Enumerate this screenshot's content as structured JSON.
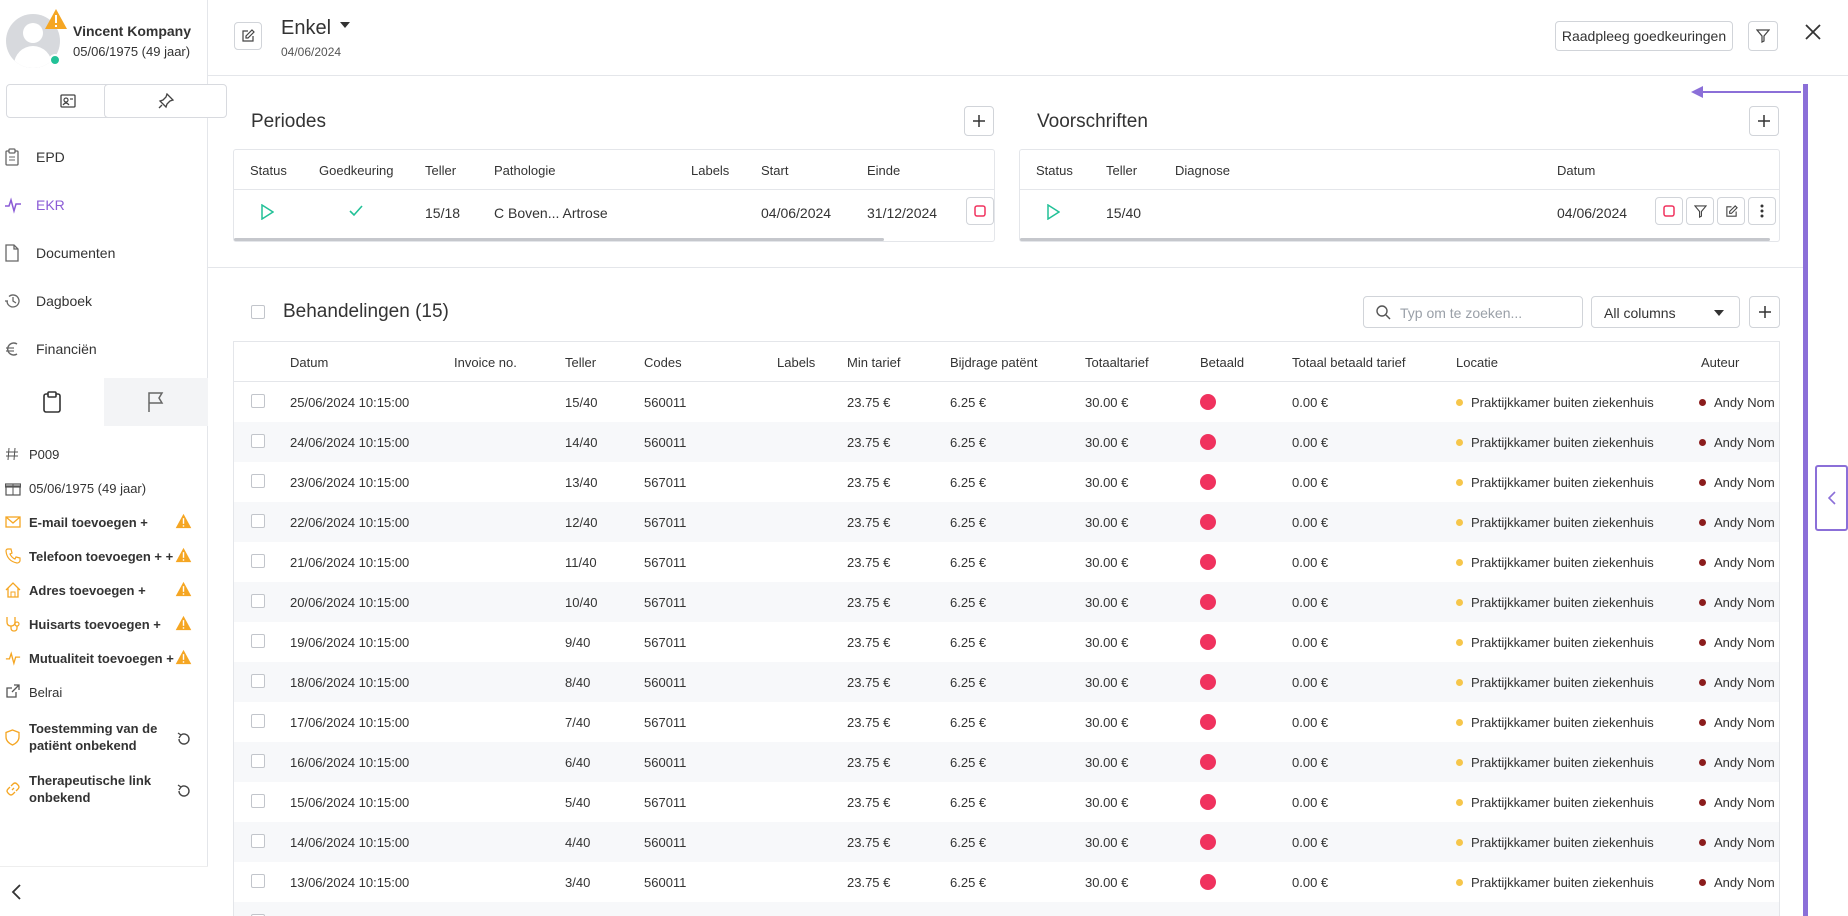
{
  "patient": {
    "name": "Vincent Kompany",
    "dob": "05/06/1975 (49 jaar)"
  },
  "nav": [
    {
      "label": "EPD",
      "icon": "clipboard-icon"
    },
    {
      "label": "EKR",
      "icon": "activity-icon"
    },
    {
      "label": "Documenten",
      "icon": "document-icon"
    },
    {
      "label": "Dagboek",
      "icon": "history-icon"
    },
    {
      "label": "Financiën",
      "icon": "euro-icon"
    }
  ],
  "info": {
    "code": "P009",
    "birthday": "05/06/1975 (49 jaar)",
    "email": "E-mail toevoegen +",
    "phone": "Telefoon toevoegen + +",
    "address": "Adres toevoegen +",
    "gp": "Huisarts toevoegen +",
    "mutuality": "Mutualiteit toevoegen +",
    "belrai": "Belrai",
    "consent_l1": "Toestemming van de",
    "consent_l2": "patiënt onbekend",
    "thera_l1": "Therapeutische link",
    "thera_l2": "onbekend"
  },
  "header": {
    "title": "Enkel",
    "date": "04/06/2024",
    "consult_button": "Raadpleeg goedkeuringen"
  },
  "periodes": {
    "title": "Periodes",
    "columns": [
      "Status",
      "Goedkeuring",
      "Teller",
      "Pathologie",
      "Labels",
      "Start",
      "Einde"
    ],
    "row": {
      "teller": "15/18",
      "pathologie": "C Boven... Artrose",
      "start": "04/06/2024",
      "einde": "31/12/2024"
    }
  },
  "voorschriften": {
    "title": "Voorschriften",
    "columns": [
      "Status",
      "Teller",
      "Diagnose",
      "Datum"
    ],
    "row": {
      "teller": "15/40",
      "datum": "04/06/2024"
    }
  },
  "behandelingen": {
    "title": "Behandelingen (15)",
    "search_placeholder": "Typ om te zoeken...",
    "column_filter": "All columns",
    "columns": [
      "Datum",
      "Invoice no.",
      "Teller",
      "Codes",
      "Labels",
      "Min tarief",
      "Bijdrage patënt",
      "Totaaltarief",
      "Betaald",
      "Totaal betaald tarief",
      "Locatie",
      "Auteur"
    ],
    "rows": [
      {
        "datum": "25/06/2024 10:15:00",
        "teller": "15/40",
        "code": "560011",
        "min": "23.75 €",
        "bijdrage": "6.25 €",
        "totaal": "30.00 €",
        "betaald_tarief": "0.00 €",
        "locatie": "Praktijkkamer buiten ziekenhuis",
        "auteur": "Andy Nom"
      },
      {
        "datum": "24/06/2024 10:15:00",
        "teller": "14/40",
        "code": "560011",
        "min": "23.75 €",
        "bijdrage": "6.25 €",
        "totaal": "30.00 €",
        "betaald_tarief": "0.00 €",
        "locatie": "Praktijkkamer buiten ziekenhuis",
        "auteur": "Andy Nom"
      },
      {
        "datum": "23/06/2024 10:15:00",
        "teller": "13/40",
        "code": "567011",
        "min": "23.75 €",
        "bijdrage": "6.25 €",
        "totaal": "30.00 €",
        "betaald_tarief": "0.00 €",
        "locatie": "Praktijkkamer buiten ziekenhuis",
        "auteur": "Andy Nom"
      },
      {
        "datum": "22/06/2024 10:15:00",
        "teller": "12/40",
        "code": "567011",
        "min": "23.75 €",
        "bijdrage": "6.25 €",
        "totaal": "30.00 €",
        "betaald_tarief": "0.00 €",
        "locatie": "Praktijkkamer buiten ziekenhuis",
        "auteur": "Andy Nom"
      },
      {
        "datum": "21/06/2024 10:15:00",
        "teller": "11/40",
        "code": "567011",
        "min": "23.75 €",
        "bijdrage": "6.25 €",
        "totaal": "30.00 €",
        "betaald_tarief": "0.00 €",
        "locatie": "Praktijkkamer buiten ziekenhuis",
        "auteur": "Andy Nom"
      },
      {
        "datum": "20/06/2024 10:15:00",
        "teller": "10/40",
        "code": "567011",
        "min": "23.75 €",
        "bijdrage": "6.25 €",
        "totaal": "30.00 €",
        "betaald_tarief": "0.00 €",
        "locatie": "Praktijkkamer buiten ziekenhuis",
        "auteur": "Andy Nom"
      },
      {
        "datum": "19/06/2024 10:15:00",
        "teller": "9/40",
        "code": "567011",
        "min": "23.75 €",
        "bijdrage": "6.25 €",
        "totaal": "30.00 €",
        "betaald_tarief": "0.00 €",
        "locatie": "Praktijkkamer buiten ziekenhuis",
        "auteur": "Andy Nom"
      },
      {
        "datum": "18/06/2024 10:15:00",
        "teller": "8/40",
        "code": "560011",
        "min": "23.75 €",
        "bijdrage": "6.25 €",
        "totaal": "30.00 €",
        "betaald_tarief": "0.00 €",
        "locatie": "Praktijkkamer buiten ziekenhuis",
        "auteur": "Andy Nom"
      },
      {
        "datum": "17/06/2024 10:15:00",
        "teller": "7/40",
        "code": "567011",
        "min": "23.75 €",
        "bijdrage": "6.25 €",
        "totaal": "30.00 €",
        "betaald_tarief": "0.00 €",
        "locatie": "Praktijkkamer buiten ziekenhuis",
        "auteur": "Andy Nom"
      },
      {
        "datum": "16/06/2024 10:15:00",
        "teller": "6/40",
        "code": "560011",
        "min": "23.75 €",
        "bijdrage": "6.25 €",
        "totaal": "30.00 €",
        "betaald_tarief": "0.00 €",
        "locatie": "Praktijkkamer buiten ziekenhuis",
        "auteur": "Andy Nom"
      },
      {
        "datum": "15/06/2024 10:15:00",
        "teller": "5/40",
        "code": "567011",
        "min": "23.75 €",
        "bijdrage": "6.25 €",
        "totaal": "30.00 €",
        "betaald_tarief": "0.00 €",
        "locatie": "Praktijkkamer buiten ziekenhuis",
        "auteur": "Andy Nom"
      },
      {
        "datum": "14/06/2024 10:15:00",
        "teller": "4/40",
        "code": "560011",
        "min": "23.75 €",
        "bijdrage": "6.25 €",
        "totaal": "30.00 €",
        "betaald_tarief": "0.00 €",
        "locatie": "Praktijkkamer buiten ziekenhuis",
        "auteur": "Andy Nom"
      },
      {
        "datum": "13/06/2024 10:15:00",
        "teller": "3/40",
        "code": "560011",
        "min": "23.75 €",
        "bijdrage": "6.25 €",
        "totaal": "30.00 €",
        "betaald_tarief": "0.00 €",
        "locatie": "Praktijkkamer buiten ziekenhuis",
        "auteur": "Andy Nom"
      }
    ]
  },
  "colors": {
    "accent": "#8b5cd6",
    "paid_status": "#f0325e",
    "location_dot": "#f6c64a",
    "author_dot": "#8b1c1c",
    "warning": "#f5a623",
    "success": "#22c197"
  }
}
